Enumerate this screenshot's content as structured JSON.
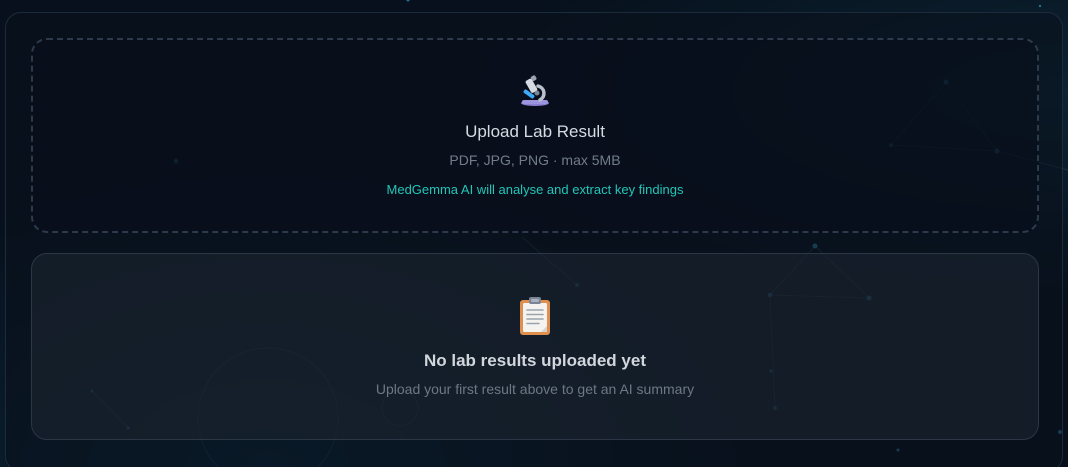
{
  "upload": {
    "icon": "microscope-icon",
    "title": "Upload Lab Result",
    "formats": "PDF, JPG, PNG · max 5MB",
    "note": "MedGemma AI will analyse and extract key findings",
    "note_color": "#22c6b8"
  },
  "empty_state": {
    "icon": "clipboard-icon",
    "title": "No lab results uploaded yet",
    "subtitle": "Upload your first result above to get an AI summary"
  }
}
